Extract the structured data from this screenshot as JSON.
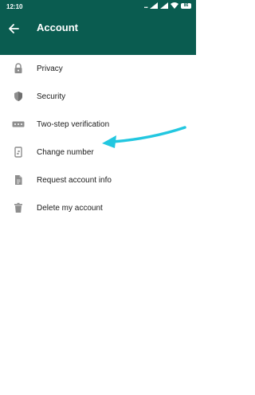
{
  "status_bar": {
    "time": "12:10",
    "signal_text": "...",
    "battery": "86"
  },
  "header": {
    "title": "Account",
    "back_icon": "arrow-left-icon"
  },
  "items": [
    {
      "label": "Privacy",
      "icon": "lock-icon"
    },
    {
      "label": "Security",
      "icon": "shield-icon"
    },
    {
      "label": "Two-step verification",
      "icon": "dots-icon"
    },
    {
      "label": "Change number",
      "icon": "phone-change-icon"
    },
    {
      "label": "Request account info",
      "icon": "document-icon"
    },
    {
      "label": "Delete my account",
      "icon": "trash-icon"
    }
  ],
  "colors": {
    "header": "#0a5c50",
    "icon": "#8e8e8e",
    "annotation_arrow": "#22c7e0"
  }
}
